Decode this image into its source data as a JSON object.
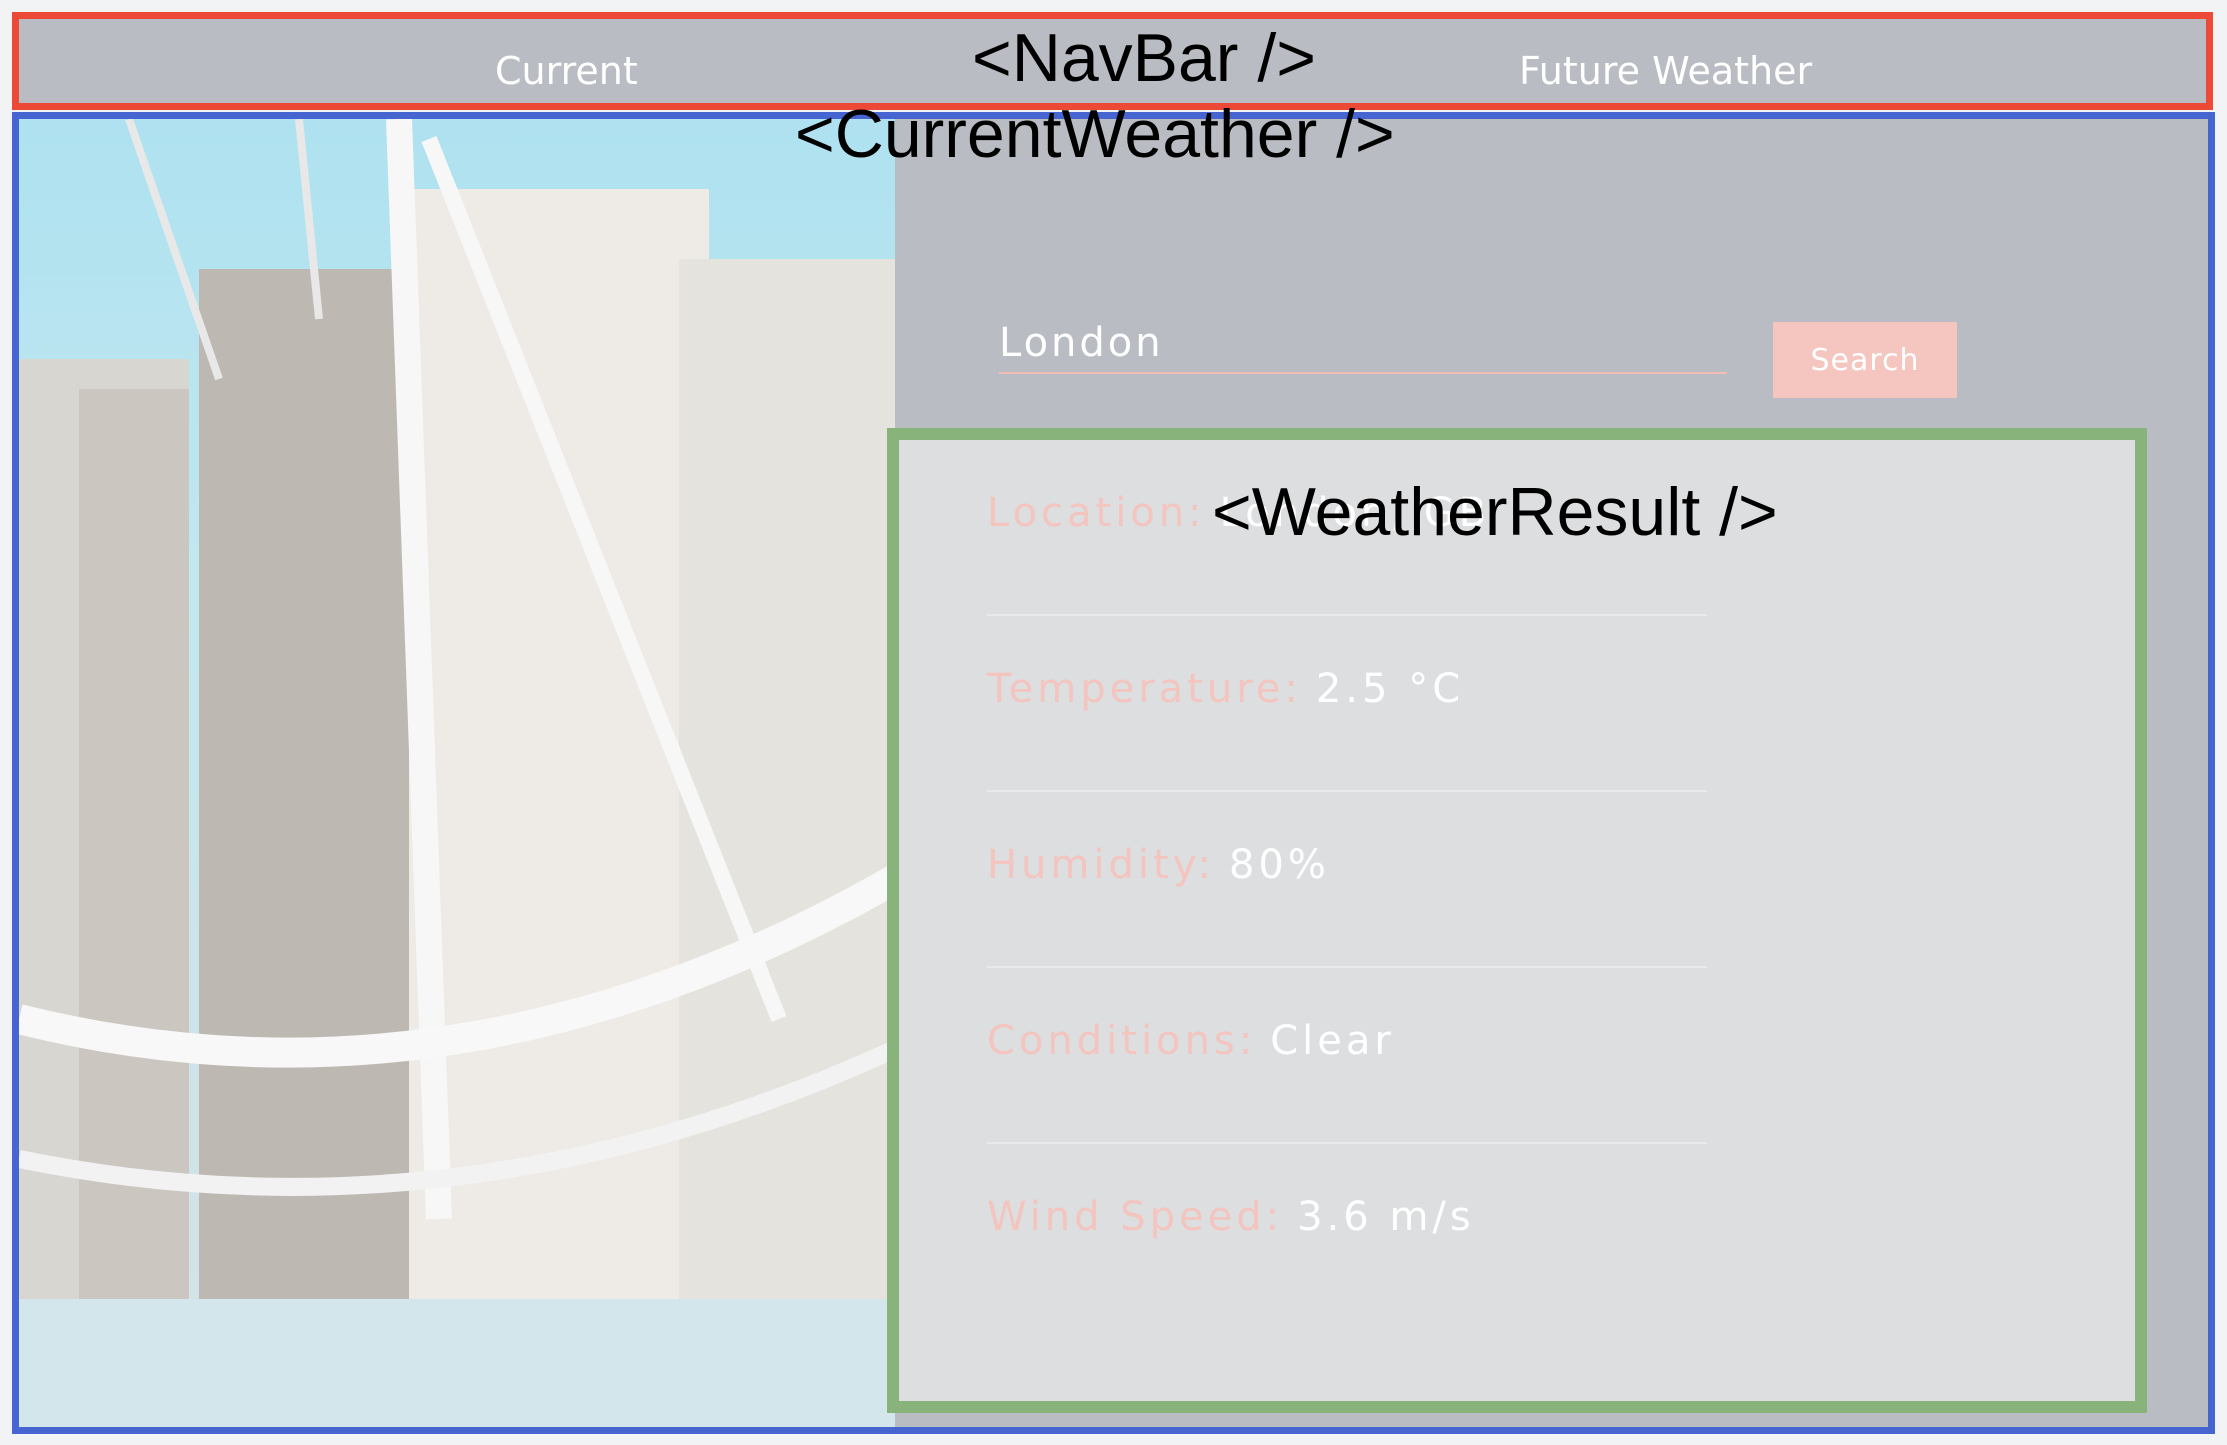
{
  "annotations": {
    "navbar": "<NavBar />",
    "current_weather": "<CurrentWeather />",
    "weather_result": "<WeatherResult />"
  },
  "navbar": {
    "links": [
      {
        "label": "Current"
      },
      {
        "label": "Future Weather"
      }
    ]
  },
  "search": {
    "value": "London",
    "button_label": "Search"
  },
  "result": {
    "rows": [
      {
        "label": "Location:",
        "value": "London, GB"
      },
      {
        "label": "Temperature:",
        "value": "2.5 °C"
      },
      {
        "label": "Humidity:",
        "value": "80%"
      },
      {
        "label": "Conditions:",
        "value": "Clear"
      },
      {
        "label": "Wind Speed:",
        "value": "3.6 m/s"
      }
    ]
  },
  "colors": {
    "navbar_border": "#ec4a37",
    "current_weather_border": "#4665d0",
    "weather_result_border": "#88b37a",
    "accent_pink": "#f5c6c0"
  },
  "icons": {
    "background_photo": "london-eye-photo"
  }
}
